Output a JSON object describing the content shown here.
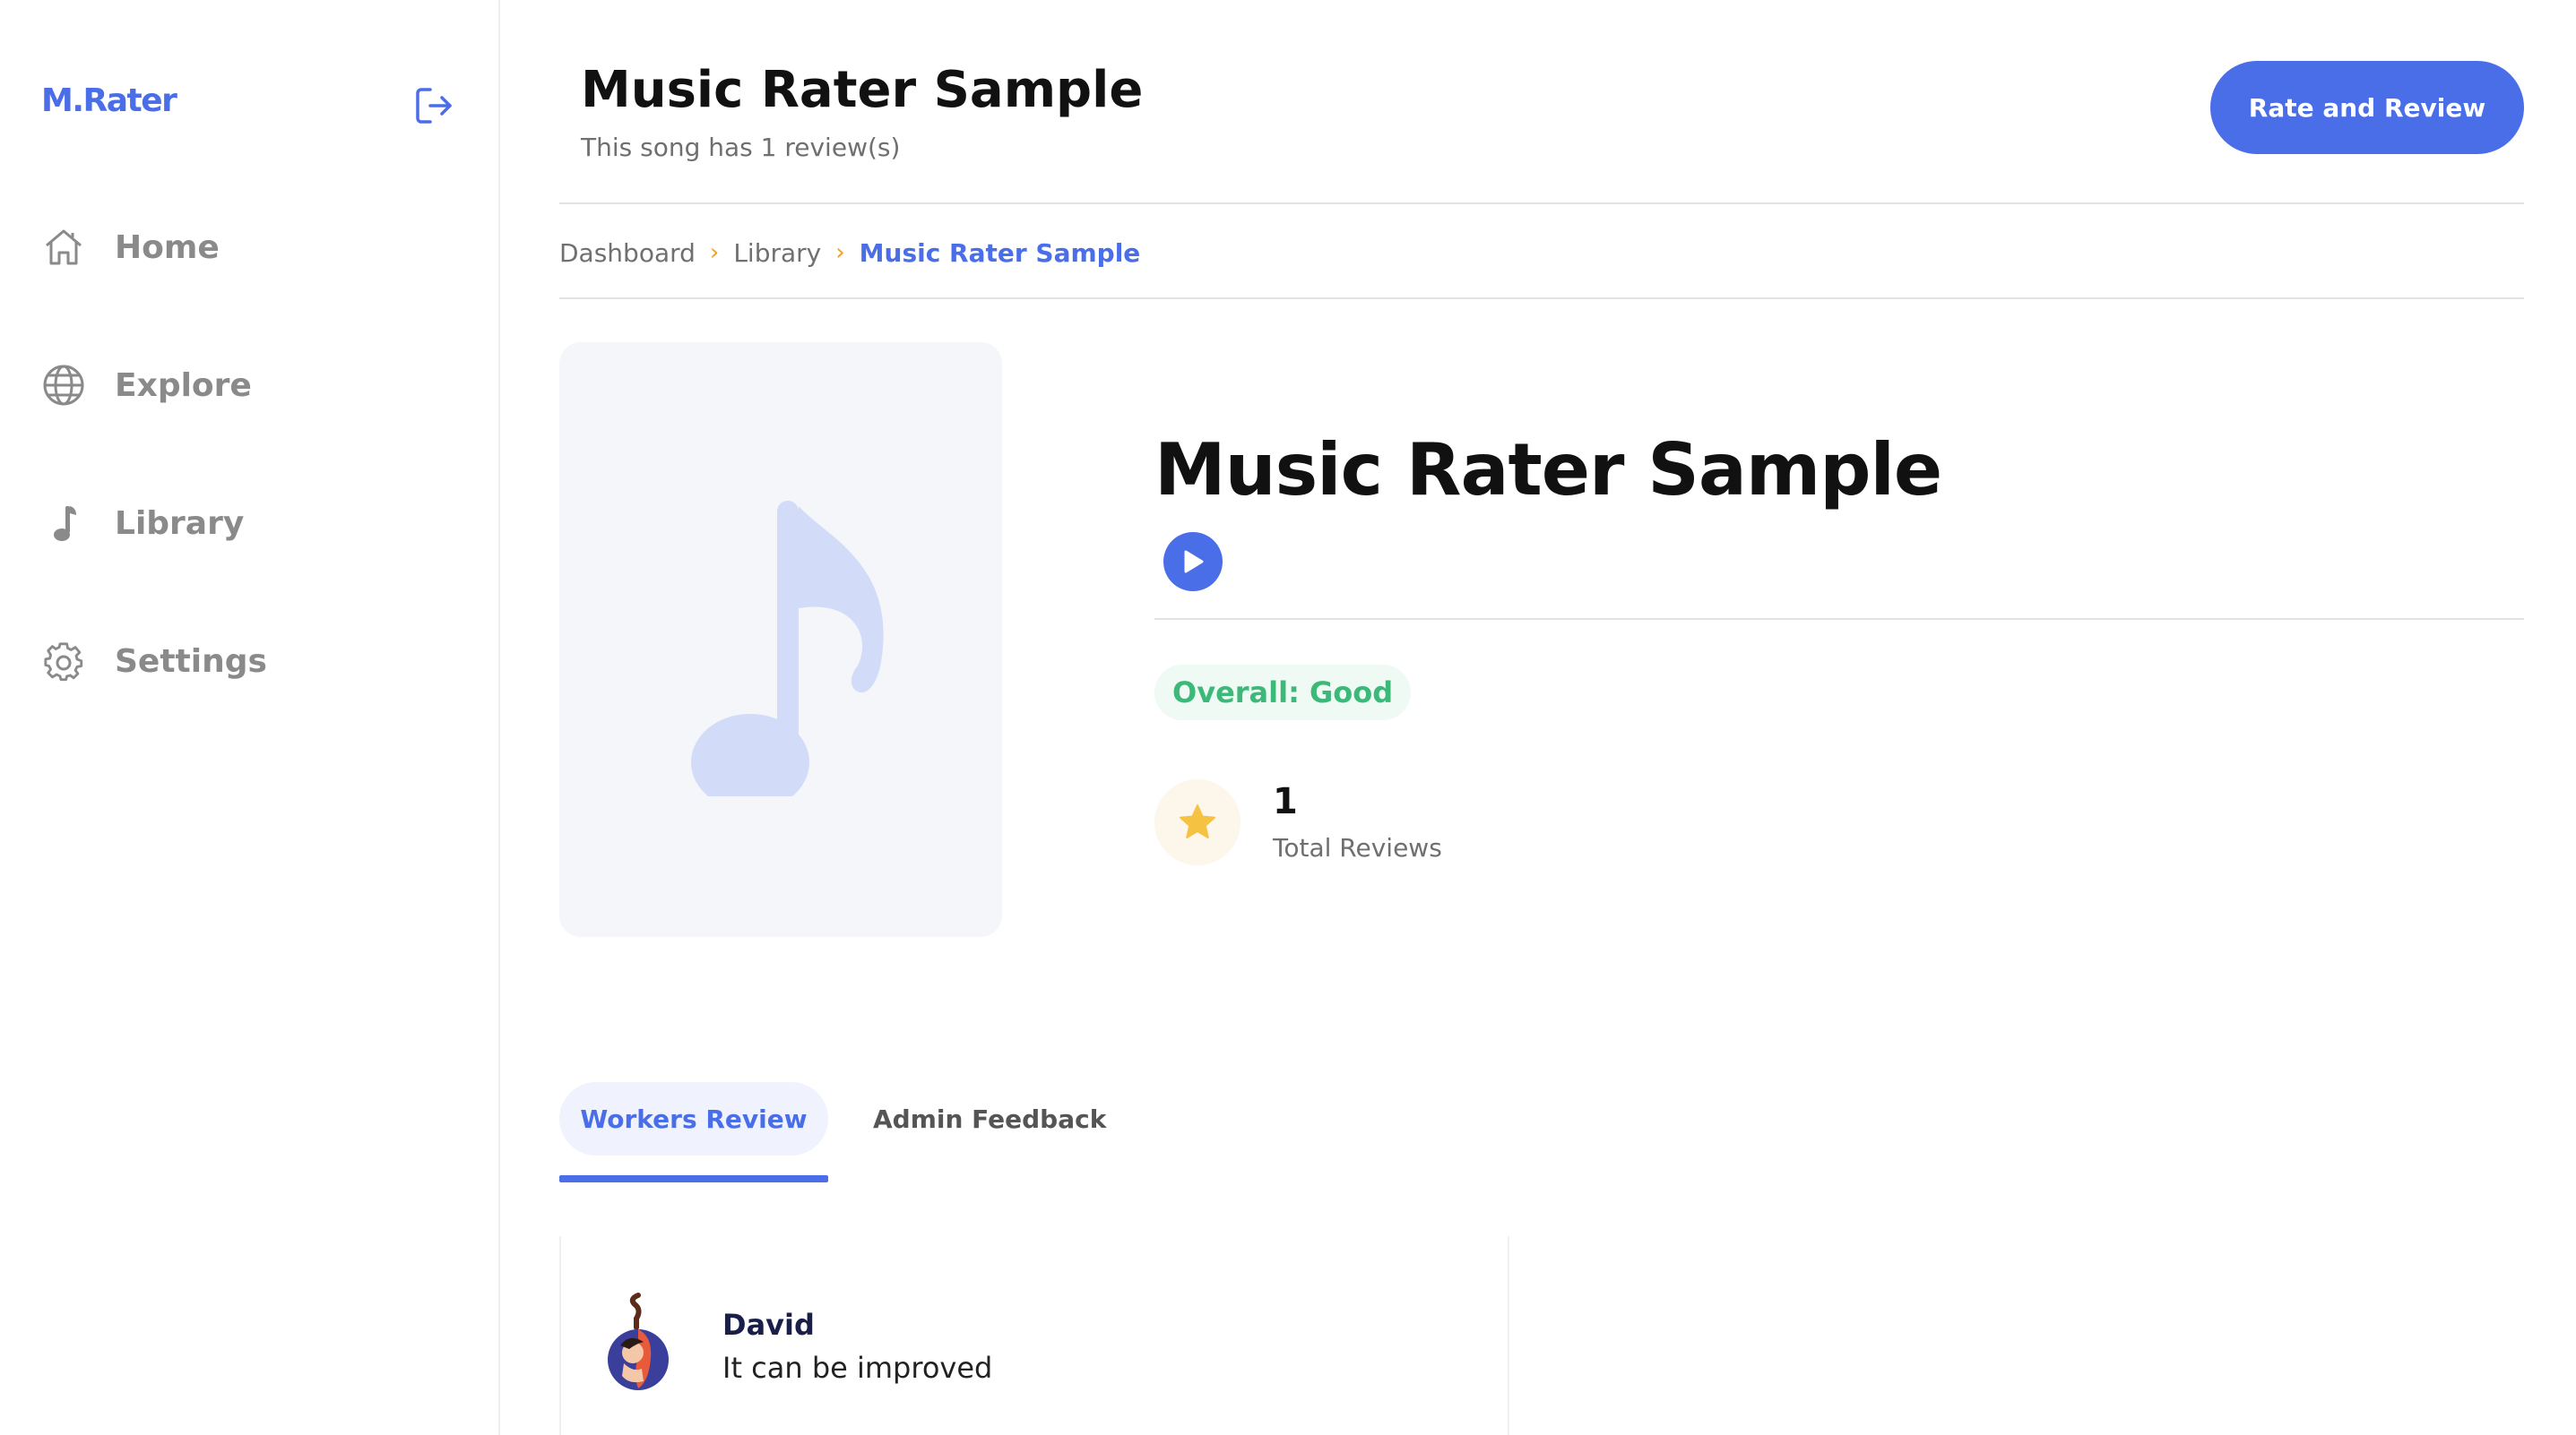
{
  "app": {
    "logo": "M.Rater"
  },
  "sidebar": {
    "items": [
      {
        "label": "Home",
        "icon": "home-icon"
      },
      {
        "label": "Explore",
        "icon": "globe-icon"
      },
      {
        "label": "Library",
        "icon": "music-note-icon"
      },
      {
        "label": "Settings",
        "icon": "gear-icon"
      }
    ]
  },
  "header": {
    "title": "Music Rater Sample",
    "subtitle": "This song has 1 review(s)",
    "action_label": "Rate and Review"
  },
  "breadcrumb": {
    "items": [
      "Dashboard",
      "Library",
      "Music Rater Sample"
    ]
  },
  "song": {
    "title": "Music Rater Sample",
    "overall": "Overall: Good",
    "total_reviews_count": "1",
    "total_reviews_label": "Total Reviews"
  },
  "tabs": [
    {
      "label": "Workers Review",
      "active": true
    },
    {
      "label": "Admin Feedback",
      "active": false
    }
  ],
  "reviews": [
    {
      "name": "David",
      "text": "It can be improved"
    }
  ],
  "colors": {
    "accent": "#4a6ee8",
    "good": "#3cb878",
    "star": "#f5c242",
    "breadcrumb_separator": "#f0a020"
  }
}
